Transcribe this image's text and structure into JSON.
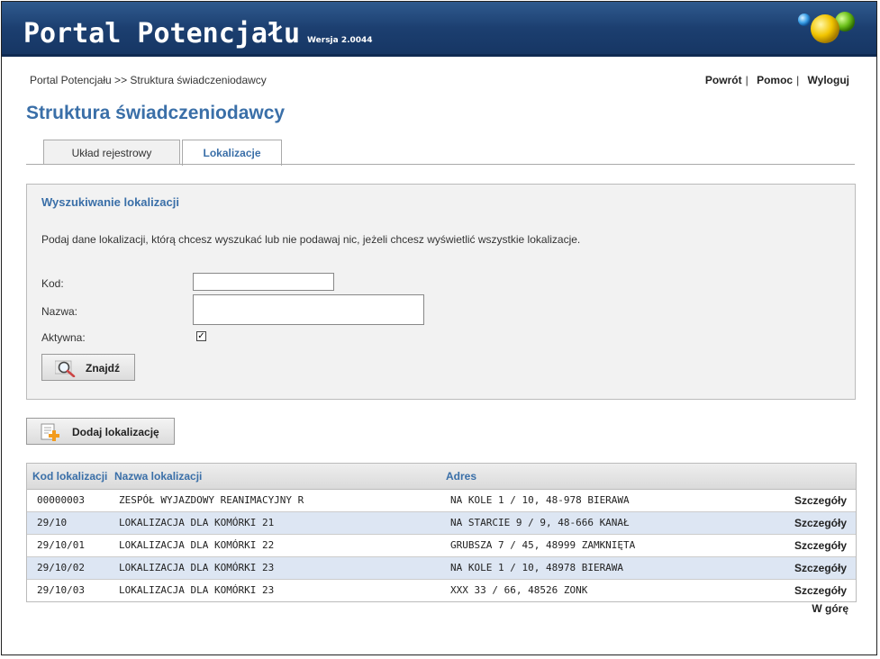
{
  "header": {
    "app_title": "Portal Potencjału",
    "version": "Wersja 2.0044",
    "logo_icon": "colored-spheres-logo"
  },
  "breadcrumb": "Portal Potencjału >> Struktura świadczeniodawcy",
  "toplinks": {
    "back": "Powrót",
    "help": "Pomoc",
    "logout": "Wyloguj"
  },
  "page_title": "Struktura świadczeniodawcy",
  "tabs": [
    {
      "label": "Układ rejestrowy",
      "active": false
    },
    {
      "label": "Lokalizacje",
      "active": true
    }
  ],
  "search": {
    "title": "Wyszukiwanie lokalizacji",
    "description": "Podaj dane lokalizacji, którą chcesz wyszukać lub nie podawaj nic, jeżeli chcesz wyświetlić wszystkie lokalizacje.",
    "code_label": "Kod:",
    "code_value": "",
    "name_label": "Nazwa:",
    "name_value": "",
    "active_label": "Aktywna:",
    "active_checked": true,
    "find_button": "Znajdź",
    "find_icon": "magnifier-icon"
  },
  "add_button": {
    "label": "Dodaj lokalizację",
    "icon": "add-document-icon"
  },
  "table": {
    "columns": [
      "Kod lokalizacji",
      "Nazwa lokalizacji",
      "Adres"
    ],
    "details_label": "Szczegóły",
    "rows": [
      {
        "code": "00000003",
        "name": "ZESPÓŁ WYJAZDOWY REANIMACYJNY R",
        "address": "NA KOLE 1 / 10, 48-978 BIERAWA"
      },
      {
        "code": "29/10",
        "name": "LOKALIZACJA DLA KOMÓRKI 21",
        "address": "NA STARCIE 9 / 9, 48-666 KANAŁ"
      },
      {
        "code": "29/10/01",
        "name": "LOKALIZACJA DLA KOMÓRKI 22",
        "address": "GRUBSZA 7 / 45, 48999 ZAMKNIĘTA"
      },
      {
        "code": "29/10/02",
        "name": "LOKALIZACJA DLA KOMÓRKI 23",
        "address": "NA KOLE 1 / 10, 48978 BIERAWA"
      },
      {
        "code": "29/10/03",
        "name": "LOKALIZACJA DLA KOMÓRKI 23",
        "address": "XXX 33 / 66, 48526 ZONK"
      }
    ]
  },
  "back_to_top": "W górę",
  "colors": {
    "header_bg": "#1c3f70",
    "accent": "#3a6fa8",
    "row_alt": "#dde6f3"
  }
}
